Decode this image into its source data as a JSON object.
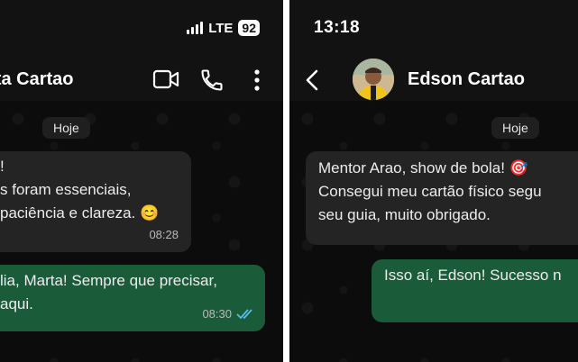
{
  "left": {
    "status": {
      "network": "LTE",
      "battery": "92"
    },
    "contact_name": "rta Cartao",
    "date_chip": "Hoje",
    "incoming": {
      "lines": [
        "!",
        "s foram essenciais,",
        "paciência e clareza. 😊"
      ],
      "time": "08:28"
    },
    "outgoing": {
      "lines": [
        "lia, Marta! Sempre que precisar,",
        "aqui."
      ],
      "time": "08:30"
    }
  },
  "right": {
    "status": {
      "time": "13:18"
    },
    "contact_name": "Edson Cartao",
    "date_chip": "Hoje",
    "incoming": {
      "lines": [
        "Mentor Arao, show de bola! 🎯",
        "Consegui meu cartão físico segu",
        "seu guia, muito obrigado."
      ]
    },
    "outgoing": {
      "lines": [
        "Isso aí, Edson! Sucesso n"
      ]
    }
  },
  "colors": {
    "header_bg": "#121212",
    "chat_bg": "#0c0c0c",
    "incoming_bubble": "#242424",
    "outgoing_bubble": "#1a5c3a",
    "read_ticks": "#53bdeb"
  }
}
